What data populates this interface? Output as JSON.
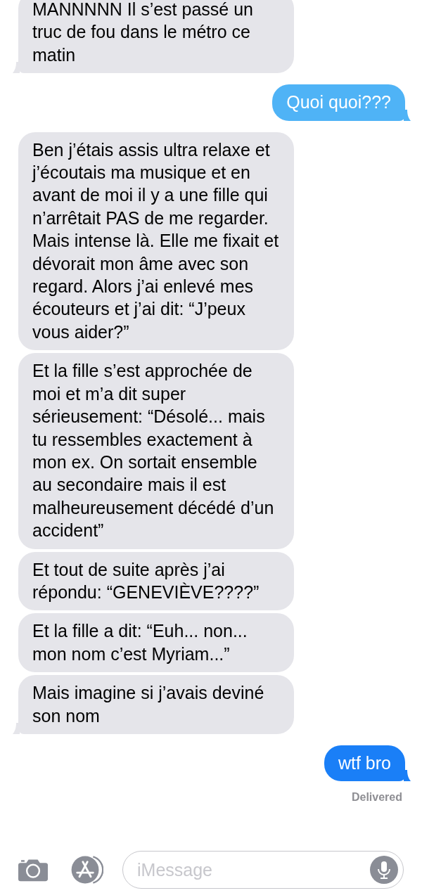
{
  "messages": [
    {
      "kind": "incoming",
      "text": "MANNNNN Il s’est passé un truc de fou dans le métro ce matin",
      "tail": true
    },
    {
      "kind": "outgoing",
      "text": "Quoi quoi???",
      "tail": true,
      "color": "#4fb3f6"
    },
    {
      "kind": "incoming",
      "text": "Ben j’étais assis ultra relaxe et j’écoutais ma musique et en avant de moi il y a une fille qui n’arrêtait PAS de me regarder. Mais intense là. Elle me fixait et dévorait mon âme avec son regard. Alors j’ai enlevé mes écouteurs et j’ai dit: “J’peux vous aider?”",
      "tail": false
    },
    {
      "kind": "incoming",
      "text": "Et la fille s’est approchée de moi et m’a dit super sérieusement: “Désolé... mais tu ressembles exactement à mon ex. On sortait ensemble au secondaire mais il est malheureusement décédé d’un accident”",
      "tail": false
    },
    {
      "kind": "incoming",
      "text": "Et tout de suite après j’ai répondu: “GENEVIÈVE????”",
      "tail": false
    },
    {
      "kind": "incoming",
      "text": "Et la fille a dit: “Euh... non... mon nom c’est Myriam...”",
      "tail": false
    },
    {
      "kind": "incoming",
      "text": "Mais imagine si j’avais deviné son nom",
      "tail": true
    },
    {
      "kind": "outgoing",
      "text": "wtf bro",
      "tail": true,
      "color": "#1a7ff7"
    }
  ],
  "status": "Delivered",
  "input": {
    "placeholder": "iMessage"
  }
}
